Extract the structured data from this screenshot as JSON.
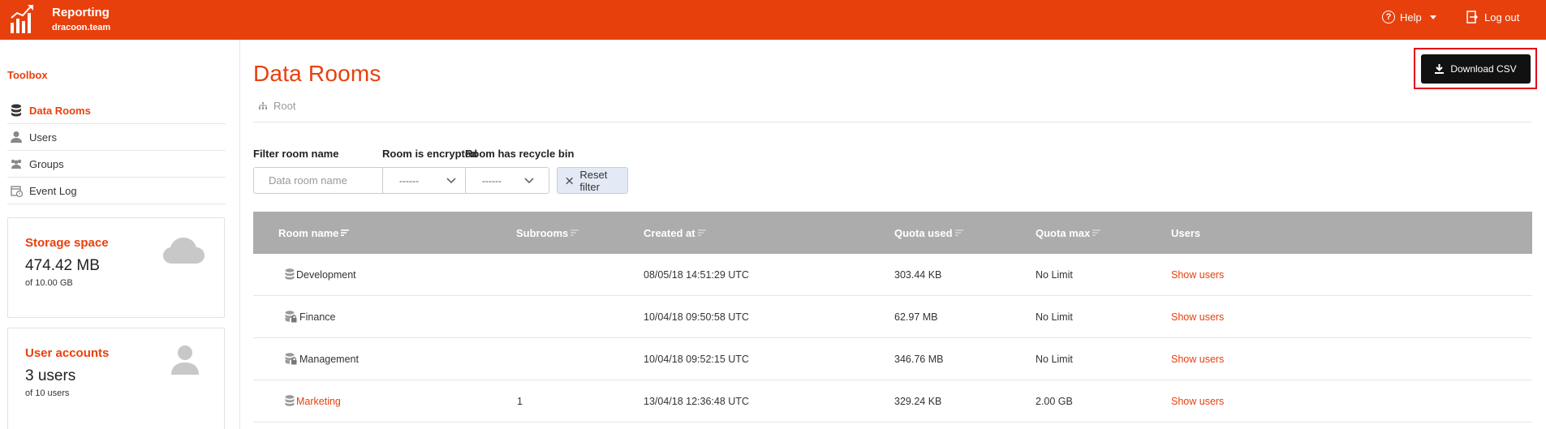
{
  "header": {
    "app_title": "Reporting",
    "app_subtitle": "dracoon.team",
    "help_label": "Help",
    "logout_label": "Log out",
    "brand_color": "#E8400C"
  },
  "sidebar": {
    "section_title": "Toolbox",
    "items": [
      {
        "label": "Data Rooms",
        "icon": "database-icon",
        "active": true
      },
      {
        "label": "Users",
        "icon": "user-icon",
        "active": false
      },
      {
        "label": "Groups",
        "icon": "group-icon",
        "active": false
      },
      {
        "label": "Event Log",
        "icon": "event-log-icon",
        "active": false
      }
    ],
    "storage_card": {
      "title": "Storage space",
      "value": "474.42 MB",
      "sub": "of 10.00 GB",
      "icon": "cloud-icon"
    },
    "users_card": {
      "title": "User accounts",
      "value": "3 users",
      "sub": "of 10 users",
      "icon": "user-icon"
    }
  },
  "main": {
    "title": "Data Rooms",
    "breadcrumb": "Root",
    "download_label": "Download CSV",
    "filters": {
      "room_name_label": "Filter room name",
      "room_name_placeholder": "Data room name",
      "encrypted_label": "Room is encrypted",
      "encrypted_value": "------",
      "recycle_label": "Room has recycle bin",
      "recycle_value": "------",
      "reset_label": "Reset filter"
    },
    "table": {
      "columns": [
        "Room name",
        "Subrooms",
        "Created at",
        "Quota used",
        "Quota max",
        "Users"
      ],
      "rows": [
        {
          "name": "Development",
          "subrooms": "",
          "created": "08/05/18 14:51:29 UTC",
          "quota_used": "303.44 KB",
          "quota_max": "No Limit",
          "users": "Show users",
          "encrypted": false,
          "is_link": false
        },
        {
          "name": "Finance",
          "subrooms": "",
          "created": "10/04/18 09:50:58 UTC",
          "quota_used": "62.97 MB",
          "quota_max": "No Limit",
          "users": "Show users",
          "encrypted": true,
          "is_link": false
        },
        {
          "name": "Management",
          "subrooms": "",
          "created": "10/04/18 09:52:15 UTC",
          "quota_used": "346.76 MB",
          "quota_max": "No Limit",
          "users": "Show users",
          "encrypted": true,
          "is_link": false
        },
        {
          "name": "Marketing",
          "subrooms": "1",
          "created": "13/04/18 12:36:48 UTC",
          "quota_used": "329.24 KB",
          "quota_max": "2.00 GB",
          "users": "Show users",
          "encrypted": false,
          "is_link": true
        }
      ]
    }
  }
}
